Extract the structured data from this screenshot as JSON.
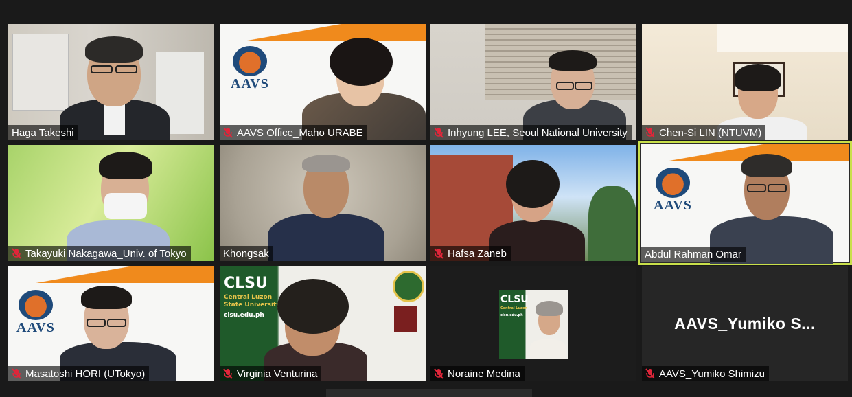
{
  "participants": [
    {
      "name": "Haga Takeshi",
      "muted": false
    },
    {
      "name": "AAVS Office_Maho URABE",
      "muted": true
    },
    {
      "name": "Inhyung LEE, Seoul National University",
      "muted": true
    },
    {
      "name": "Chen-Si LIN (NTUVM)",
      "muted": true
    },
    {
      "name": "Takayuki Nakagawa_Univ. of Tokyo",
      "muted": true
    },
    {
      "name": "Khongsak",
      "muted": false
    },
    {
      "name": "Hafsa Zaneb",
      "muted": true
    },
    {
      "name": "Abdul Rahman Omar",
      "muted": false,
      "active_speaker": true
    },
    {
      "name": "Masatoshi HORI (UTokyo)",
      "muted": true
    },
    {
      "name": "Virginia Venturina",
      "muted": true
    },
    {
      "name": "Noraine Medina",
      "muted": true
    },
    {
      "name": "AAVS_Yumiko Shimizu",
      "muted": true,
      "video_off_label": "AAVS_Yumiko S..."
    }
  ],
  "logos": {
    "aavs": "AAVS",
    "clsu": "CLSU",
    "clsu_sub1": "Central Luzon",
    "clsu_sub2": "State University",
    "clsu_url": "clsu.edu.ph"
  },
  "colors": {
    "active_border": "#c9e04a",
    "muted_icon": "#e0263a",
    "aavs_orange": "#f08a1c",
    "clsu_green": "#1f5a2a"
  },
  "icons": {
    "muted": "mic-off-icon"
  }
}
